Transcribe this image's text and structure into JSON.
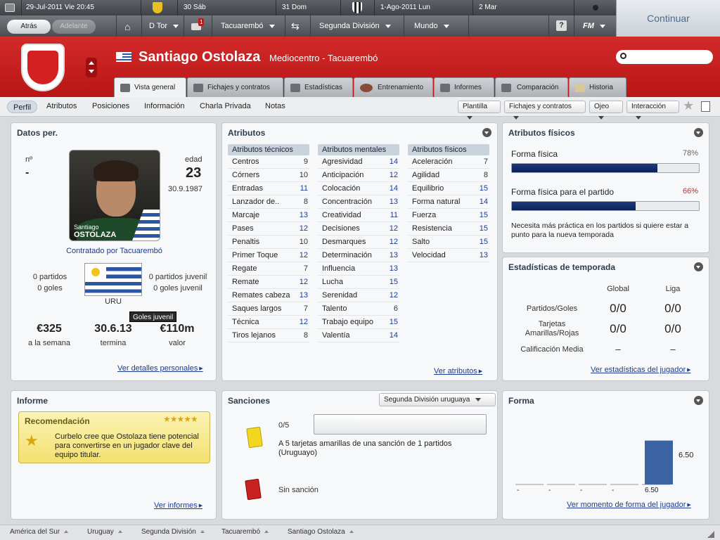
{
  "topbar": {
    "date": "29-Jul-2011 Vie 20:45",
    "cal": [
      {
        "day": "30 Sáb"
      },
      {
        "day": "31 Dom"
      },
      {
        "day": "1-Ago-2011 Lun"
      },
      {
        "day": "2 Mar"
      }
    ],
    "continue_label": "Continuar"
  },
  "navbar": {
    "back": "Atrás",
    "forward": "Adelante",
    "manager": "D Tor",
    "inbox_count": "1",
    "club": "Tacuarembó",
    "competition": "Segunda División",
    "world": "Mundo",
    "help": "?",
    "fm": "FM"
  },
  "player": {
    "name": "Santiago Ostolaza",
    "role": "Mediocentro - Tacuarembó"
  },
  "tabs": [
    {
      "label": "Vista general"
    },
    {
      "label": "Fichajes y contratos"
    },
    {
      "label": "Estadísticas"
    },
    {
      "label": "Entrenamiento"
    },
    {
      "label": "Informes"
    },
    {
      "label": "Comparación"
    },
    {
      "label": "Historia"
    }
  ],
  "subnav": {
    "links": [
      "Perfil",
      "Atributos",
      "Posiciones",
      "Información",
      "Charla Privada",
      "Notas"
    ],
    "dropdowns": [
      "Plantilla",
      "Fichajes y contratos",
      "Ojeo",
      "Interacción"
    ]
  },
  "datos": {
    "title": "Datos per.",
    "num_label": "nº",
    "num_value": "-",
    "edad_label": "edad",
    "edad_value": "23",
    "dob": "30.9.1987",
    "photo_first": "Santiago",
    "photo_last": "OSTOLAZA",
    "contract": "Contratado por Tacuarembó",
    "partidos": "0 partidos",
    "goles": "0 goles",
    "partidos_juv": "0 partidos juvenil",
    "goles_juv": "0 goles juvenil",
    "nation": "URU",
    "tooltip": "Goles juvenil",
    "wage": "€325",
    "wage_label": "a la semana",
    "expires": "30.6.13",
    "expires_label": "termina",
    "value": "€110m",
    "value_label": "valor",
    "link": "Ver detalles personales"
  },
  "atributos": {
    "title": "Atributos",
    "tecnicos_title": "Atributos técnicos",
    "mentales_title": "Atributos mentales",
    "fisicos_title": "Atributos físicos",
    "tecnicos": [
      {
        "name": "Centros",
        "value": "9"
      },
      {
        "name": "Córners",
        "value": "10"
      },
      {
        "name": "Entradas",
        "value": "11"
      },
      {
        "name": "Lanzador de..",
        "value": "8"
      },
      {
        "name": "Marcaje",
        "value": "13"
      },
      {
        "name": "Pases",
        "value": "12"
      },
      {
        "name": "Penaltis",
        "value": "10"
      },
      {
        "name": "Primer Toque",
        "value": "12"
      },
      {
        "name": "Regate",
        "value": "7"
      },
      {
        "name": "Remate",
        "value": "12"
      },
      {
        "name": "Remates cabeza",
        "value": "13"
      },
      {
        "name": "Saques largos",
        "value": "7"
      },
      {
        "name": "Técnica",
        "value": "12"
      },
      {
        "name": "Tiros lejanos",
        "value": "8"
      }
    ],
    "mentales": [
      {
        "name": "Agresividad",
        "value": "14"
      },
      {
        "name": "Anticipación",
        "value": "12"
      },
      {
        "name": "Colocación",
        "value": "14"
      },
      {
        "name": "Concentración",
        "value": "13"
      },
      {
        "name": "Creatividad",
        "value": "11"
      },
      {
        "name": "Decisiones",
        "value": "12"
      },
      {
        "name": "Desmarques",
        "value": "12"
      },
      {
        "name": "Determinación",
        "value": "13"
      },
      {
        "name": "Influencia",
        "value": "13"
      },
      {
        "name": "Lucha",
        "value": "15"
      },
      {
        "name": "Serenidad",
        "value": "12"
      },
      {
        "name": "Talento",
        "value": "6"
      },
      {
        "name": "Trabajo equipo",
        "value": "15"
      },
      {
        "name": "Valentía",
        "value": "14"
      }
    ],
    "fisicos": [
      {
        "name": "Aceleración",
        "value": "7"
      },
      {
        "name": "Agilidad",
        "value": "8"
      },
      {
        "name": "Equilibrio",
        "value": "15"
      },
      {
        "name": "Forma natural",
        "value": "14"
      },
      {
        "name": "Fuerza",
        "value": "15"
      },
      {
        "name": "Resistencia",
        "value": "15"
      },
      {
        "name": "Salto",
        "value": "15"
      },
      {
        "name": "Velocidad",
        "value": "13"
      }
    ],
    "link": "Ver atributos"
  },
  "fisicos_panel": {
    "title": "Atributos físicos",
    "forma_label": "Forma física",
    "forma_pct": "78%",
    "forma_fill": 0.78,
    "partido_label": "Forma física para el partido",
    "partido_pct": "66%",
    "partido_fill": 0.66,
    "note": "Necesita más práctica en los partidos si quiere estar a punto para la nueva temporada"
  },
  "temporada": {
    "title": "Estadísticas de temporada",
    "col_global": "Global",
    "col_liga": "Liga",
    "rows": [
      {
        "label": "Partidos/Goles",
        "global": "0/0",
        "liga": "0/0"
      },
      {
        "label": "Tarjetas Amarillas/Rojas",
        "global": "0/0",
        "liga": "0/0"
      },
      {
        "label": "Calificación Media",
        "global": "–",
        "liga": "–"
      }
    ],
    "link": "Ver estadísticas del jugador"
  },
  "informe": {
    "title": "Informe",
    "box_title": "Recomendación",
    "stars": "★★★★★",
    "text": "Curbelo cree que Ostolaza tiene potencial para convertirse en un jugador clave del equipo titular.",
    "link": "Ver informes"
  },
  "sanciones": {
    "title": "Sanciones",
    "league": "Segunda División uruguaya",
    "yellow_count": "0/5",
    "yellow_fill": 0,
    "yellow_text": "A 5 tarjetas amarillas de una sanción de 1 partidos (Uruguayo)",
    "red_text": "Sin sanción"
  },
  "forma": {
    "title": "Forma",
    "labels": [
      "-",
      "-",
      "-",
      "-",
      "6.50"
    ],
    "bar_value": "6.50",
    "link": "Ver momento de forma del jugador"
  },
  "chart_data": {
    "type": "bar",
    "categories": [
      "1",
      "2",
      "3",
      "4",
      "5"
    ],
    "values": [
      null,
      null,
      null,
      null,
      6.5
    ],
    "title": "",
    "xlabel": "",
    "ylabel": ""
  },
  "breadcrumbs": [
    "América del Sur",
    "Uruguay",
    "Segunda División",
    "Tacuarembó",
    "Santiago Ostolaza"
  ],
  "colors": {
    "header_red": "#c81e1e",
    "accent_blue": "#1a3a99",
    "bar_navy": "#0b2258",
    "forma_bar": "#3b63a3"
  }
}
